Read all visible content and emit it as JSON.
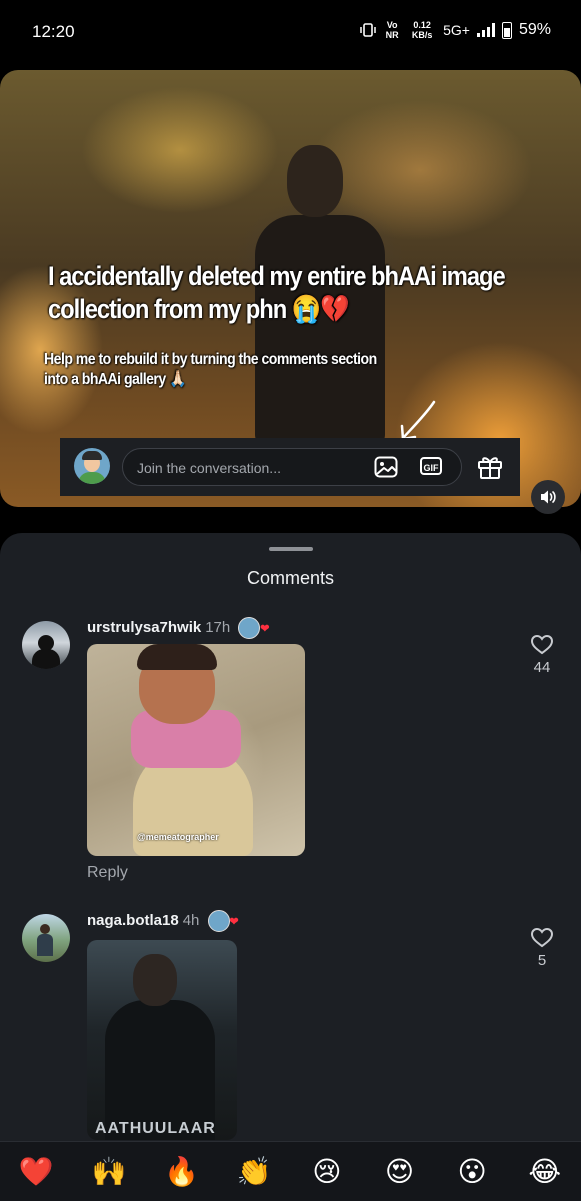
{
  "status_bar": {
    "time": "12:20",
    "volte": "Vo NR",
    "speed": "0.12 KB/s",
    "network": "5G+",
    "battery": "59%"
  },
  "video": {
    "caption_line1": "I accidentally deleted my entire bhAAi image collection from my phn 😭💔",
    "caption_line2": "Help me to rebuild it by turning the comments section into a bhAAi gallery 🙏🏻",
    "compose_placeholder": "Join the conversation...",
    "gif_label": "GIF"
  },
  "comments_sheet": {
    "title": "Comments",
    "comments": [
      {
        "username": "urstrulysa7hwik",
        "time": "17h",
        "media_watermark": "@memeatographer",
        "reply_label": "Reply",
        "likes": "44"
      },
      {
        "username": "naga.botla18",
        "time": "4h",
        "media_caption": "AATHUULAAR",
        "likes": "5"
      }
    ]
  },
  "emoji_bar": [
    "❤️",
    "🙌",
    "🔥",
    "👏",
    "😢",
    "😍",
    "😮",
    "😂"
  ],
  "colors": {
    "sheet_bg": "#1c1f24",
    "accent_heart": "#ff3040"
  }
}
